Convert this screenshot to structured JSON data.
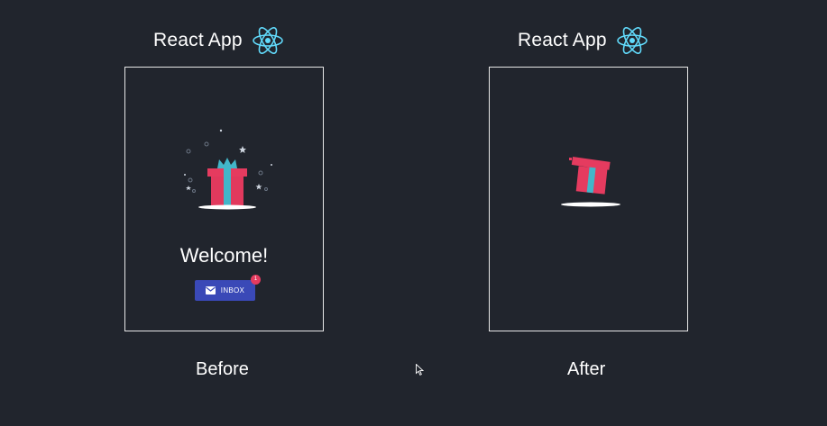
{
  "left_panel": {
    "app_title": "React App",
    "welcome_text": "Welcome!",
    "inbox_label": "INBOX",
    "inbox_badge": "1",
    "caption": "Before"
  },
  "right_panel": {
    "app_title": "React App",
    "caption": "After"
  },
  "icons": [
    "react-logo-icon",
    "gift-icon",
    "mail-icon",
    "cursor-icon"
  ],
  "colors": {
    "background": "#21252d",
    "react_logo": "#61dafb",
    "gift_red": "#e53b5f",
    "gift_ribbon": "#42b6c9",
    "button": "#3a49b7",
    "frame_border": "#e8e8e8"
  }
}
